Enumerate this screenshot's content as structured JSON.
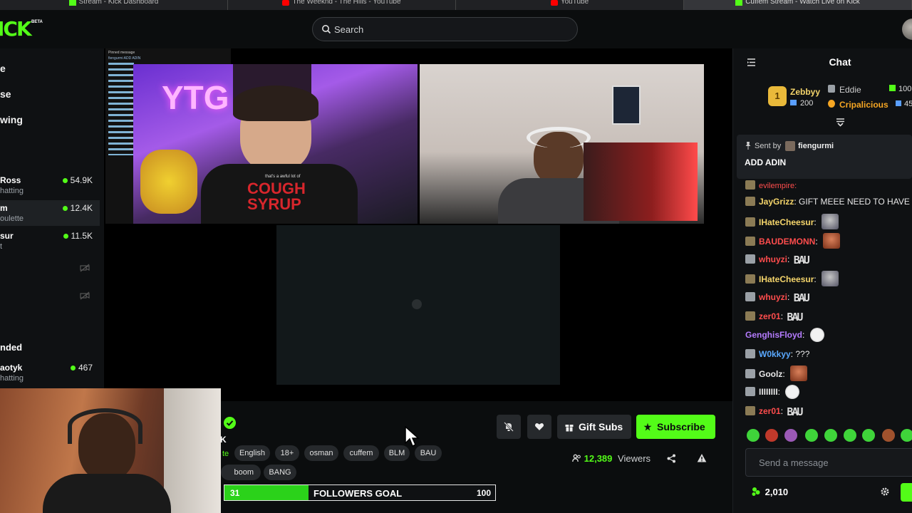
{
  "browser_tabs": [
    {
      "title": "Stream - Kick Dashboard",
      "icon": "kick-icon",
      "active": false
    },
    {
      "title": "The Weeknd - The Hills - YouTube",
      "icon": "youtube-icon",
      "active": false
    },
    {
      "title": "YouTube",
      "icon": "youtube-icon",
      "active": false
    },
    {
      "title": "Cuffem Stream - Watch Live on Kick",
      "icon": "kick-icon",
      "active": true
    }
  ],
  "header": {
    "logo_text": "ICK",
    "beta_label": "BETA",
    "search_placeholder": "Search"
  },
  "sidebar": {
    "nav": [
      "e",
      "se",
      "wing"
    ],
    "following": [
      {
        "name": "Ross",
        "sub": "hatting",
        "viewers": "54.9K",
        "live": true
      },
      {
        "name": "m",
        "sub": "oulette",
        "viewers": "12.4K",
        "live": true
      },
      {
        "name": "sur",
        "sub": "t",
        "viewers": "11.5K",
        "live": true
      },
      {
        "name": "",
        "sub": "",
        "viewers": "",
        "live": false
      },
      {
        "name": "",
        "sub": "",
        "viewers": "",
        "live": false
      }
    ],
    "recommended_label": "nded",
    "recommended": [
      {
        "name": "aotyk",
        "sub": "hatting",
        "viewers": "467",
        "live": true
      }
    ]
  },
  "video": {
    "cam1_sign": "YTG",
    "cam1_shirt_small": "that's a awful lot of",
    "cam1_shirt": "COUGH SYRUP",
    "overlay_chat": [
      "Pinned message",
      "fiengurmi ADD ADIN"
    ]
  },
  "stream_info": {
    "channel_initial": "K",
    "category": "te",
    "tags": [
      "English",
      "18+",
      "osman",
      "cuffem",
      "BLM",
      "BAU",
      "boom",
      "BANG"
    ],
    "viewers_count": "12,389",
    "viewers_label": "Viewers",
    "gift_subs_label": "Gift Subs",
    "subscribe_label": "Subscribe",
    "goal": {
      "current": "31",
      "label": "FOLLOWERS GOAL",
      "target": "100",
      "progress": 0.31
    }
  },
  "chat": {
    "title": "Chat",
    "leaderboard": [
      {
        "rank": "1",
        "name": "Zebbyy",
        "value": "200"
      },
      {
        "name": "Eddie",
        "value": "100"
      },
      {
        "name": "Cripalicious",
        "value": "45"
      }
    ],
    "pinned": {
      "sent_by_label": "Sent by",
      "sender": "fiengurmi",
      "text": "ADD ADIN"
    },
    "messages": [
      {
        "user": "JayGrizz",
        "color": "#f5d56b",
        "text": "GIFT MEEE NEED TO HAVE BADGE",
        "emote": null
      },
      {
        "user": "IHateCheesur",
        "color": "#f5d56b",
        "text": "",
        "emote": "face"
      },
      {
        "user": "BAUDEMONN",
        "color": "#ff4d4d",
        "text": "",
        "emote": "face2"
      },
      {
        "user": "whuyzi",
        "color": "#ff4d4d",
        "text": "",
        "emote": "bau"
      },
      {
        "user": "IHateCheesur",
        "color": "#f5d56b",
        "text": "",
        "emote": "face"
      },
      {
        "user": "whuyzi",
        "color": "#ff4d4d",
        "text": "",
        "emote": "bau"
      },
      {
        "user": "zer01",
        "color": "#ff4d4d",
        "text": "",
        "emote": "bau"
      },
      {
        "user": "GenghisFloyd",
        "color": "#b57cff",
        "text": "",
        "emote": "skull"
      },
      {
        "user": "W0kkyy",
        "color": "#5aa9ff",
        "text": "???",
        "emote": null
      },
      {
        "user": "Goolz",
        "color": "#e8e8e8",
        "text": "",
        "emote": "face2"
      },
      {
        "user": "IIIIIIII",
        "color": "#e8e8e8",
        "text": "",
        "emote": "skull"
      },
      {
        "user": "zer01",
        "color": "#ff4d4d",
        "text": "",
        "emote": "bau"
      }
    ],
    "bau_text": "BAU",
    "input_placeholder": "Send a message",
    "points": "2,010"
  },
  "colors": {
    "accent": "#53fc18",
    "bg": "#0b0d0e",
    "panel": "#0f1113"
  }
}
